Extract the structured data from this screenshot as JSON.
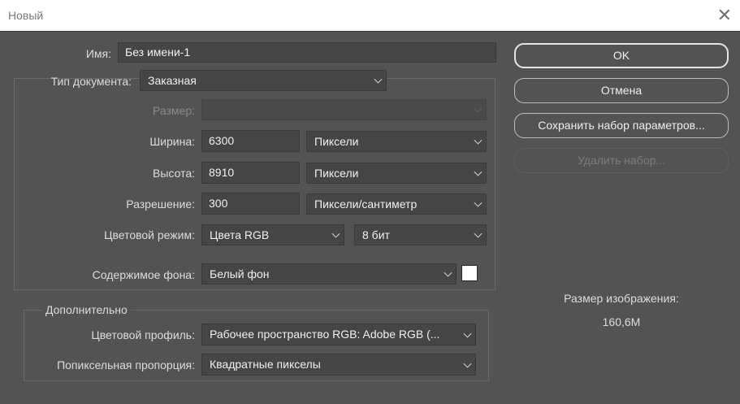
{
  "window": {
    "title": "Новый"
  },
  "name": {
    "label": "Имя:",
    "value": "Без имени-1"
  },
  "doc_type": {
    "label": "Тип документа:",
    "value": "Заказная"
  },
  "size": {
    "label": "Размер:",
    "value": ""
  },
  "width": {
    "label": "Ширина:",
    "value": "6300",
    "unit": "Пиксели"
  },
  "height": {
    "label": "Высота:",
    "value": "8910",
    "unit": "Пиксели"
  },
  "resolution": {
    "label": "Разрешение:",
    "value": "300",
    "unit": "Пиксели/сантиметр"
  },
  "color_mode": {
    "label": "Цветовой режим:",
    "value": "Цвета RGB",
    "bits": "8 бит"
  },
  "background": {
    "label": "Содержимое фона:",
    "value": "Белый фон",
    "swatch_color": "#ffffff"
  },
  "advanced": {
    "legend": "Дополнительно",
    "profile": {
      "label": "Цветовой профиль:",
      "value": "Рабочее пространство RGB:  Adobe RGB (..."
    },
    "aspect": {
      "label": "Попиксельная пропорция:",
      "value": "Квадратные пикселы"
    }
  },
  "buttons": {
    "ok": "OK",
    "cancel": "Отмена",
    "save_preset": "Сохранить набор параметров...",
    "delete_preset": "Удалить набор..."
  },
  "image_size": {
    "label": "Размер изображения:",
    "value": "160,6M"
  },
  "colors": {
    "dialog_bg": "#535353",
    "field_bg": "#454545",
    "titlebar_bg": "#ffffff"
  }
}
